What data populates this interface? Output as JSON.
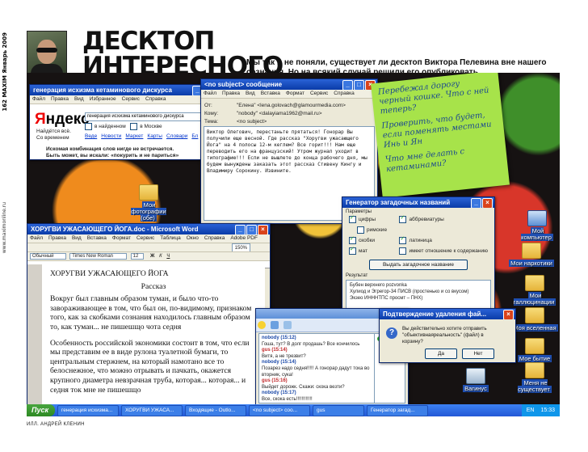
{
  "page": {
    "number": "162",
    "magazine": "MAXIM",
    "issue": "Январь 2009",
    "site": "www.maximonline.ru",
    "credit": "ИЛЛ. АНДРЕЙ КЛЕНИН"
  },
  "header": {
    "title": "ДЕСКТОП ИНТЕРЕСНОГО ЧЕЛОВЕКА",
    "subtitle": "Мы так и не поняли, существует ли десктоп Виктора Пелевина вне нашего сознания. Но на всякий случай решили его опубликовать."
  },
  "yandex_window": {
    "title": "генерация исхизма кетаминового дискурса",
    "menu": [
      "Файл",
      "Правка",
      "Вид",
      "Избранное",
      "Сервис",
      "Справка"
    ],
    "logo_first": "Я",
    "logo_rest": "ндекс",
    "found_line1": "Найдётся всё.",
    "found_line2": "Со временем",
    "query": "генерация исхизма кетаминового дискурса",
    "opt_found": "в найденном",
    "opt_city": "в Москве",
    "tabs": [
      "Веде",
      "Новости",
      "Маркет",
      "Карты",
      "Словари",
      "Бл"
    ],
    "message_line1": "Искомая комбинация слов нигде не встречается.",
    "message_line2": "Быть может, вы искали: «покурить и не париться»"
  },
  "email_window": {
    "title": "<no subject> сообщение",
    "menu": [
      "Файл",
      "Правка",
      "Вид",
      "Вставка",
      "Формат",
      "Сервис",
      "Справка"
    ],
    "from_label": "От:",
    "from_value": "\"Елена\" <lena.golovach@glamourmedia.com>",
    "to_label": "Кому:",
    "to_value": "\"nobody\" <dalayiama1962@mail.ru>",
    "subject_label": "Тема:",
    "subject_value": "<no subject>",
    "body": "Виктор Олегович, перестаньте прятаться! Гонорар Вы получили еще весной. Где рассказ \"Хоругви ужасающего Йога\" на 4 полосы 12-м кеглем? Все горит!!! Нам еще переводить его на французский! Утром журнал уходит в типографию!!! Если не вышлете до конца рабочего дня, мы будем вынуждены заказать этот рассказ Стивену Кингу и Владимиру Сорокину. Извините."
  },
  "sticky_note": {
    "line1": "Перебежал дорогу черный кошке. Что с ней теперь?",
    "line2": "Проверить, что будет, если поменять местами Инь и Ян",
    "line3": "Что мне делать с кетаминами?"
  },
  "word_window": {
    "title": "ХОРУГВИ УЖАСАЮЩЕГО ЙОГА.doc - Microsoft Word",
    "menu": [
      "Файл",
      "Правка",
      "Вид",
      "Вставка",
      "Формат",
      "Сервис",
      "Таблица",
      "Окно",
      "Справка",
      "Adobe PDF"
    ],
    "style": "Обычный",
    "font": "Times New Roman",
    "size": "12",
    "zoom": "150%",
    "doc_title": "ХОРУГВИ УЖАСАЮЩЕГО ЙОГА",
    "doc_subtitle": "Рассказ",
    "para1": "Вокруг был главным образом туман, и было что-то завораживающее в том, что был он, по-видимому, признаком того, как за скобками сознания находилось главным образом то, как туман... не пишешщо чота седня",
    "para2": "Особенность российской экономики состоит в том, что если мы представим ее в виде рулона туалетной бумаги, то центральным стержнем, на который намотано все то белоснежное, что можно отрывать и пачкать, окажется крупного диаметра невзрачная труба, которая... которая... и седня ток мне не пишешщо"
  },
  "generator_window": {
    "title": "Генератор загадочных названий",
    "params_label": "Параметры",
    "options_left": [
      {
        "label": "цифры",
        "checked": true
      },
      {
        "label": "римские",
        "checked": false
      },
      {
        "label": "скобки",
        "checked": true
      },
      {
        "label": "мат",
        "checked": true
      }
    ],
    "options_right": [
      {
        "label": "аббревиатуры",
        "checked": true
      },
      {
        "label": "латиница",
        "checked": true
      },
      {
        "label": "имеет отношение к содержанию",
        "checked": false
      }
    ],
    "button": "Выдать загадочное название",
    "result_label": "Результат",
    "results": [
      "Бубен верхнего pozvonka",
      "Хулиод и Эгрегор-34 ПИСВ (простенько и со вкусом)",
      "Экзео ИНННТПС просмт – ПНХ)"
    ]
  },
  "chat_window": {
    "log": [
      {
        "nick": "nobody (15:12)",
        "text": "Гоша, тут? В долг продашь? Все кончилось",
        "me": true
      },
      {
        "nick": "gus (15:14)",
        "text": "Витя, а не трезвит?",
        "me": false
      },
      {
        "nick": "nobody (15:14)",
        "text": "Позарез надо седня!!!!! А гонорар дадут тока во вторник, сука!",
        "me": true
      },
      {
        "nick": "gus (15:16)",
        "text": "Выйдет дорожк. Скажи: скока везти?",
        "me": false
      },
      {
        "nick": "nobody (15:17)",
        "text": "Все, скока есть!!!!!!!!!!!!",
        "me": true
      }
    ],
    "user": "gus"
  },
  "confirm_dialog": {
    "title": "Подтверждение удаления фай...",
    "text": "Вы действительно хотите отправить \"объективнаяреальность\" (файл) в корзину?",
    "yes": "Да",
    "no": "Нет"
  },
  "desktop_icons": [
    {
      "label": "Мои фотографии (обе)",
      "kind": "folder"
    },
    {
      "label": "Мой компьютер",
      "kind": "pc"
    },
    {
      "label": "Мои наркотики",
      "kind": "folder"
    },
    {
      "label": "Мои галлюцинации",
      "kind": "folder"
    },
    {
      "label": "Моя вселенная",
      "kind": "folder"
    },
    {
      "label": "Мое бытие",
      "kind": "folder"
    },
    {
      "label": "Меня не существует",
      "kind": "folder"
    },
    {
      "label": "Вагинус",
      "kind": "trash"
    }
  ],
  "taskbar": {
    "start": "Пуск",
    "tasks": [
      "генерация исхизма...",
      "ХОРУГВИ УЖАСА...",
      "Входящие - Outlo...",
      "<no subject> соо...",
      "gus",
      "Генератор загад..."
    ],
    "lang": "EN",
    "clock": "15:33"
  }
}
